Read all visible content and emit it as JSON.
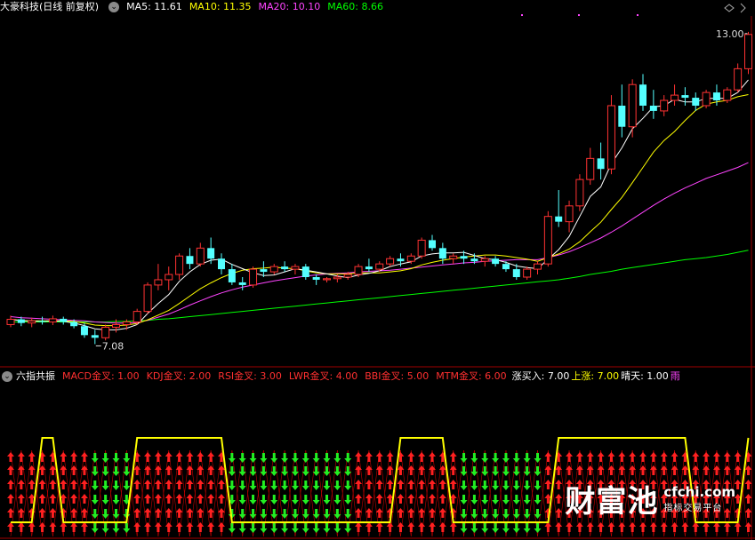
{
  "top_header": {
    "stock": "大豪科技(日线 前复权)",
    "ma": [
      {
        "label": "MA5: 11.61",
        "color": "#ffffff"
      },
      {
        "label": "MA10: 11.35",
        "color": "#ffff00"
      },
      {
        "label": "MA20: 10.10",
        "color": "#ff44ff"
      },
      {
        "label": "MA60: 8.66",
        "color": "#00ff00"
      }
    ]
  },
  "bottom_header": {
    "name": "六指共振",
    "items": [
      {
        "label": "MACD金叉: 1.00",
        "color": "#ff3030"
      },
      {
        "label": "KDJ金叉: 2.00",
        "color": "#ff3030"
      },
      {
        "label": "RSI金叉: 3.00",
        "color": "#ff3030"
      },
      {
        "label": "LWR金叉: 4.00",
        "color": "#ff3030"
      },
      {
        "label": "BBI金叉: 5.00",
        "color": "#ff3030"
      },
      {
        "label": "MTM金叉: 6.00",
        "color": "#ff3030"
      },
      {
        "label": "涨买入: 7.00",
        "color": "#ffffff"
      },
      {
        "label": "上涨: 7.00",
        "color": "#ffff00"
      },
      {
        "label": "晴天: 1.00",
        "color": "#ffffff"
      },
      {
        "label": "雨",
        "color": "#ff44ff"
      }
    ]
  },
  "watermark": {
    "cn": "财富池",
    "url": "cfchi.com",
    "sub": "指标交易平台"
  },
  "colors": {
    "up": "#ff3232",
    "down": "#54ffff",
    "ma5": "#ffffff",
    "ma10": "#ffff00",
    "ma20": "#ff44ff",
    "ma60": "#00ff00",
    "signal": "#ffff00",
    "arrow_up": "#ff2020",
    "arrow_down": "#22ee22",
    "axis": "#b00000"
  },
  "chart_data": [
    {
      "type": "candlestick",
      "title": "大豪科技(日线 前复权)",
      "price_labels": {
        "high": "13.00",
        "low": "7.08"
      },
      "ylim": [
        6.7,
        13.3
      ],
      "candles": [
        [
          7.45,
          7.62,
          7.4,
          7.55
        ],
        [
          7.55,
          7.6,
          7.42,
          7.48
        ],
        [
          7.48,
          7.58,
          7.4,
          7.52
        ],
        [
          7.52,
          7.6,
          7.45,
          7.5
        ],
        [
          7.5,
          7.62,
          7.44,
          7.56
        ],
        [
          7.56,
          7.6,
          7.45,
          7.5
        ],
        [
          7.5,
          7.55,
          7.38,
          7.42
        ],
        [
          7.42,
          7.48,
          7.2,
          7.25
        ],
        [
          7.25,
          7.35,
          7.08,
          7.2
        ],
        [
          7.2,
          7.45,
          7.15,
          7.4
        ],
        [
          7.4,
          7.55,
          7.3,
          7.45
        ],
        [
          7.45,
          7.55,
          7.35,
          7.5
        ],
        [
          7.5,
          7.75,
          7.45,
          7.7
        ],
        [
          7.7,
          8.25,
          7.65,
          8.2
        ],
        [
          8.2,
          8.6,
          8.1,
          8.3
        ],
        [
          8.3,
          8.55,
          8.1,
          8.4
        ],
        [
          8.4,
          8.8,
          8.3,
          8.75
        ],
        [
          8.75,
          8.9,
          8.5,
          8.6
        ],
        [
          8.6,
          9.0,
          8.55,
          8.9
        ],
        [
          8.9,
          9.1,
          8.6,
          8.7
        ],
        [
          8.7,
          8.8,
          8.4,
          8.5
        ],
        [
          8.5,
          8.6,
          8.2,
          8.25
        ],
        [
          8.25,
          8.35,
          8.1,
          8.2
        ],
        [
          8.2,
          8.55,
          8.15,
          8.5
        ],
        [
          8.5,
          8.65,
          8.35,
          8.45
        ],
        [
          8.45,
          8.6,
          8.4,
          8.55
        ],
        [
          8.55,
          8.65,
          8.45,
          8.5
        ],
        [
          8.5,
          8.6,
          8.4,
          8.55
        ],
        [
          8.55,
          8.6,
          8.3,
          8.35
        ],
        [
          8.35,
          8.4,
          8.2,
          8.3
        ],
        [
          8.3,
          8.35,
          8.25,
          8.32
        ],
        [
          8.32,
          8.4,
          8.25,
          8.35
        ],
        [
          8.35,
          8.45,
          8.3,
          8.4
        ],
        [
          8.4,
          8.6,
          8.35,
          8.55
        ],
        [
          8.55,
          8.7,
          8.45,
          8.5
        ],
        [
          8.5,
          8.65,
          8.45,
          8.6
        ],
        [
          8.6,
          8.75,
          8.55,
          8.7
        ],
        [
          8.7,
          8.8,
          8.55,
          8.65
        ],
        [
          8.65,
          8.8,
          8.6,
          8.75
        ],
        [
          8.75,
          9.1,
          8.7,
          9.05
        ],
        [
          9.05,
          9.15,
          8.85,
          8.9
        ],
        [
          8.9,
          9.0,
          8.6,
          8.7
        ],
        [
          8.7,
          8.8,
          8.6,
          8.75
        ],
        [
          8.75,
          8.85,
          8.6,
          8.7
        ],
        [
          8.7,
          8.8,
          8.6,
          8.65
        ],
        [
          8.65,
          8.75,
          8.55,
          8.7
        ],
        [
          8.7,
          8.75,
          8.55,
          8.6
        ],
        [
          8.6,
          8.65,
          8.45,
          8.5
        ],
        [
          8.5,
          8.6,
          8.3,
          8.35
        ],
        [
          8.35,
          8.55,
          8.3,
          8.5
        ],
        [
          8.5,
          8.65,
          8.4,
          8.6
        ],
        [
          8.6,
          9.6,
          8.55,
          9.5
        ],
        [
          9.5,
          10.0,
          9.3,
          9.4
        ],
        [
          9.4,
          9.8,
          9.2,
          9.7
        ],
        [
          9.7,
          10.3,
          9.6,
          10.2
        ],
        [
          10.2,
          10.8,
          10.1,
          10.6
        ],
        [
          10.6,
          10.9,
          10.2,
          10.4
        ],
        [
          10.4,
          11.8,
          10.3,
          11.6
        ],
        [
          11.6,
          12.0,
          11.0,
          11.2
        ],
        [
          11.2,
          12.1,
          11.0,
          12.0
        ],
        [
          12.0,
          12.2,
          11.5,
          11.6
        ],
        [
          11.6,
          11.9,
          11.35,
          11.5
        ],
        [
          11.5,
          11.8,
          11.4,
          11.7
        ],
        [
          11.7,
          12.0,
          11.6,
          11.8
        ],
        [
          11.8,
          11.95,
          11.6,
          11.75
        ],
        [
          11.75,
          11.85,
          11.5,
          11.6
        ],
        [
          11.6,
          11.9,
          11.55,
          11.85
        ],
        [
          11.85,
          12.0,
          11.6,
          11.7
        ],
        [
          11.7,
          11.95,
          11.65,
          11.9
        ],
        [
          11.9,
          12.4,
          11.85,
          12.3
        ],
        [
          12.3,
          13.0,
          12.2,
          12.95
        ]
      ],
      "ma5": [
        7.55,
        7.52,
        7.52,
        7.51,
        7.52,
        7.51,
        7.48,
        7.43,
        7.37,
        7.35,
        7.35,
        7.38,
        7.45,
        7.66,
        7.85,
        8.02,
        8.27,
        8.45,
        8.59,
        8.67,
        8.69,
        8.59,
        8.51,
        8.43,
        8.38,
        8.39,
        8.45,
        8.51,
        8.48,
        8.45,
        8.41,
        8.37,
        8.34,
        8.39,
        8.42,
        8.47,
        8.55,
        8.6,
        8.64,
        8.75,
        8.79,
        8.81,
        8.81,
        8.82,
        8.76,
        8.7,
        8.68,
        8.63,
        8.56,
        8.53,
        8.51,
        8.69,
        8.87,
        9.12,
        9.5,
        9.88,
        10.06,
        10.5,
        10.8,
        11.16,
        11.36,
        11.58,
        11.6,
        11.72,
        11.67,
        11.67,
        11.74,
        11.74,
        11.74,
        11.85,
        12.09
      ],
      "ma10": [
        7.55,
        7.53,
        7.52,
        7.52,
        7.52,
        7.52,
        7.51,
        7.48,
        7.44,
        7.43,
        7.43,
        7.44,
        7.47,
        7.54,
        7.63,
        7.72,
        7.85,
        7.99,
        8.13,
        8.24,
        8.34,
        8.42,
        8.48,
        8.51,
        8.52,
        8.54,
        8.52,
        8.51,
        8.47,
        8.43,
        8.41,
        8.41,
        8.41,
        8.43,
        8.43,
        8.43,
        8.45,
        8.47,
        8.51,
        8.58,
        8.63,
        8.67,
        8.7,
        8.73,
        8.75,
        8.77,
        8.77,
        8.75,
        8.72,
        8.69,
        8.65,
        8.72,
        8.79,
        8.88,
        9.02,
        9.21,
        9.39,
        9.63,
        9.86,
        10.14,
        10.43,
        10.72,
        10.94,
        11.11,
        11.32,
        11.51,
        11.63,
        11.67,
        11.7,
        11.77,
        11.81
      ],
      "ma20": [
        7.6,
        7.58,
        7.57,
        7.56,
        7.55,
        7.54,
        7.53,
        7.52,
        7.5,
        7.49,
        7.48,
        7.48,
        7.49,
        7.53,
        7.59,
        7.65,
        7.73,
        7.82,
        7.9,
        7.98,
        8.05,
        8.11,
        8.16,
        8.2,
        8.24,
        8.28,
        8.31,
        8.34,
        8.37,
        8.39,
        8.41,
        8.42,
        8.43,
        8.45,
        8.46,
        8.47,
        8.48,
        8.5,
        8.52,
        8.54,
        8.56,
        8.58,
        8.6,
        8.62,
        8.63,
        8.65,
        8.66,
        8.67,
        8.68,
        8.68,
        8.68,
        8.72,
        8.77,
        8.83,
        8.91,
        9.0,
        9.09,
        9.2,
        9.32,
        9.45,
        9.58,
        9.71,
        9.83,
        9.94,
        10.04,
        10.13,
        10.22,
        10.29,
        10.36,
        10.43,
        10.52
      ],
      "ma60": [
        7.5,
        7.5,
        7.5,
        7.5,
        7.5,
        7.5,
        7.5,
        7.5,
        7.5,
        7.5,
        7.51,
        7.51,
        7.52,
        7.53,
        7.55,
        7.56,
        7.58,
        7.6,
        7.62,
        7.64,
        7.66,
        7.68,
        7.7,
        7.72,
        7.74,
        7.76,
        7.78,
        7.8,
        7.82,
        7.84,
        7.86,
        7.88,
        7.9,
        7.92,
        7.94,
        7.96,
        7.98,
        8.0,
        8.02,
        8.04,
        8.06,
        8.08,
        8.1,
        8.12,
        8.14,
        8.16,
        8.18,
        8.2,
        8.22,
        8.24,
        8.26,
        8.28,
        8.3,
        8.33,
        8.36,
        8.4,
        8.43,
        8.46,
        8.5,
        8.53,
        8.56,
        8.59,
        8.62,
        8.65,
        8.68,
        8.7,
        8.72,
        8.75,
        8.78,
        8.82,
        8.86
      ]
    },
    {
      "type": "area",
      "title": "六指共振",
      "signal_levels": [
        1,
        1,
        1,
        7,
        7,
        1,
        1,
        1,
        1,
        1,
        1,
        1,
        7,
        7,
        7,
        7,
        7,
        7,
        7,
        7,
        7,
        1,
        1,
        1,
        1,
        1,
        1,
        1,
        1,
        1,
        1,
        1,
        1,
        1,
        1,
        1,
        1,
        7,
        7,
        7,
        7,
        7,
        1,
        1,
        1,
        1,
        1,
        1,
        1,
        1,
        1,
        1,
        7,
        7,
        7,
        7,
        7,
        7,
        7,
        7,
        7,
        7,
        7,
        7,
        7,
        1,
        1,
        1,
        1,
        1,
        7
      ],
      "arrows": [
        "up",
        "up",
        "up",
        "up",
        "up",
        "up",
        "up",
        "up",
        "down",
        "down",
        "down",
        "down",
        "up",
        "up",
        "up",
        "up",
        "up",
        "up",
        "up",
        "up",
        "up",
        "down",
        "down",
        "down",
        "down",
        "down",
        "down",
        "down",
        "down",
        "down",
        "down",
        "down",
        "down",
        "up",
        "up",
        "up",
        "up",
        "up",
        "up",
        "up",
        "up",
        "up",
        "up",
        "down",
        "down",
        "down",
        "down",
        "down",
        "down",
        "down",
        "down",
        "up",
        "up",
        "up",
        "up",
        "up",
        "up",
        "up",
        "up",
        "up",
        "up",
        "up",
        "up",
        "up",
        "up",
        "up",
        "up",
        "up",
        "up",
        "up",
        "up"
      ]
    }
  ]
}
